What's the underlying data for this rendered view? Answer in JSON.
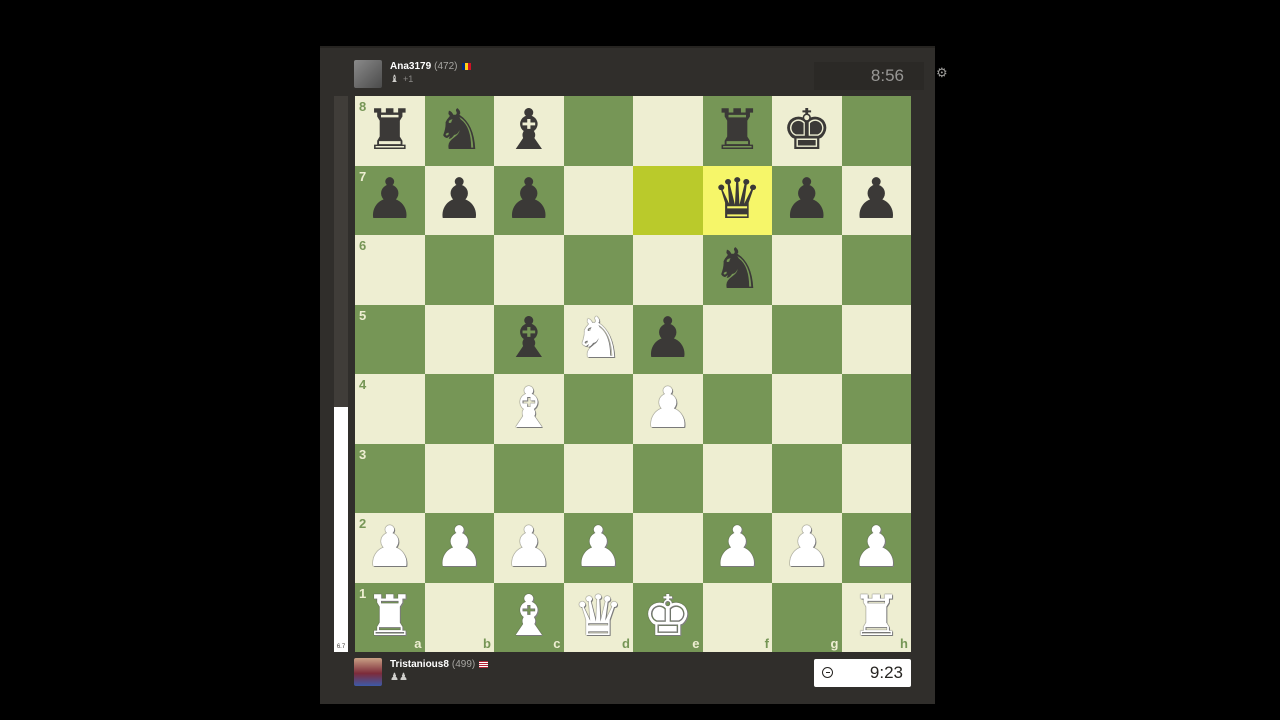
{
  "top_player": {
    "name": "Ana3179",
    "rating": "(472)",
    "captured": "♝",
    "advantage": "+1",
    "clock": "8:56"
  },
  "bottom_player": {
    "name": "Tristanious8",
    "rating": "(499)",
    "captured": "♟♟",
    "clock": "9:23"
  },
  "colors": {
    "light_square": "#eeeed2",
    "dark_square": "#769656",
    "highlight_light": "#f6f669",
    "highlight_dark": "#baca2b"
  },
  "eval_bar": {
    "white_fraction": 0.44,
    "label": "6.7"
  },
  "highlighted_squares": [
    "e7",
    "f7"
  ],
  "board": [
    [
      "r",
      "n",
      "b",
      "",
      "",
      "r",
      "k",
      ""
    ],
    [
      "p",
      "p",
      "p",
      "",
      "",
      "q",
      "p",
      "p"
    ],
    [
      "",
      "",
      "",
      "",
      "",
      "n",
      "",
      ""
    ],
    [
      "",
      "",
      "b",
      "N",
      "p",
      "",
      "",
      ""
    ],
    [
      "",
      "",
      "B",
      "",
      "P",
      "",
      "",
      ""
    ],
    [
      "",
      "",
      "",
      "",
      "",
      "",
      "",
      ""
    ],
    [
      "P",
      "P",
      "P",
      "P",
      "",
      "P",
      "P",
      "P"
    ],
    [
      "R",
      "",
      "B",
      "Q",
      "K",
      "",
      "",
      "R"
    ]
  ],
  "ranks": [
    "8",
    "7",
    "6",
    "5",
    "4",
    "3",
    "2",
    "1"
  ],
  "files": [
    "a",
    "b",
    "c",
    "d",
    "e",
    "f",
    "g",
    "h"
  ]
}
